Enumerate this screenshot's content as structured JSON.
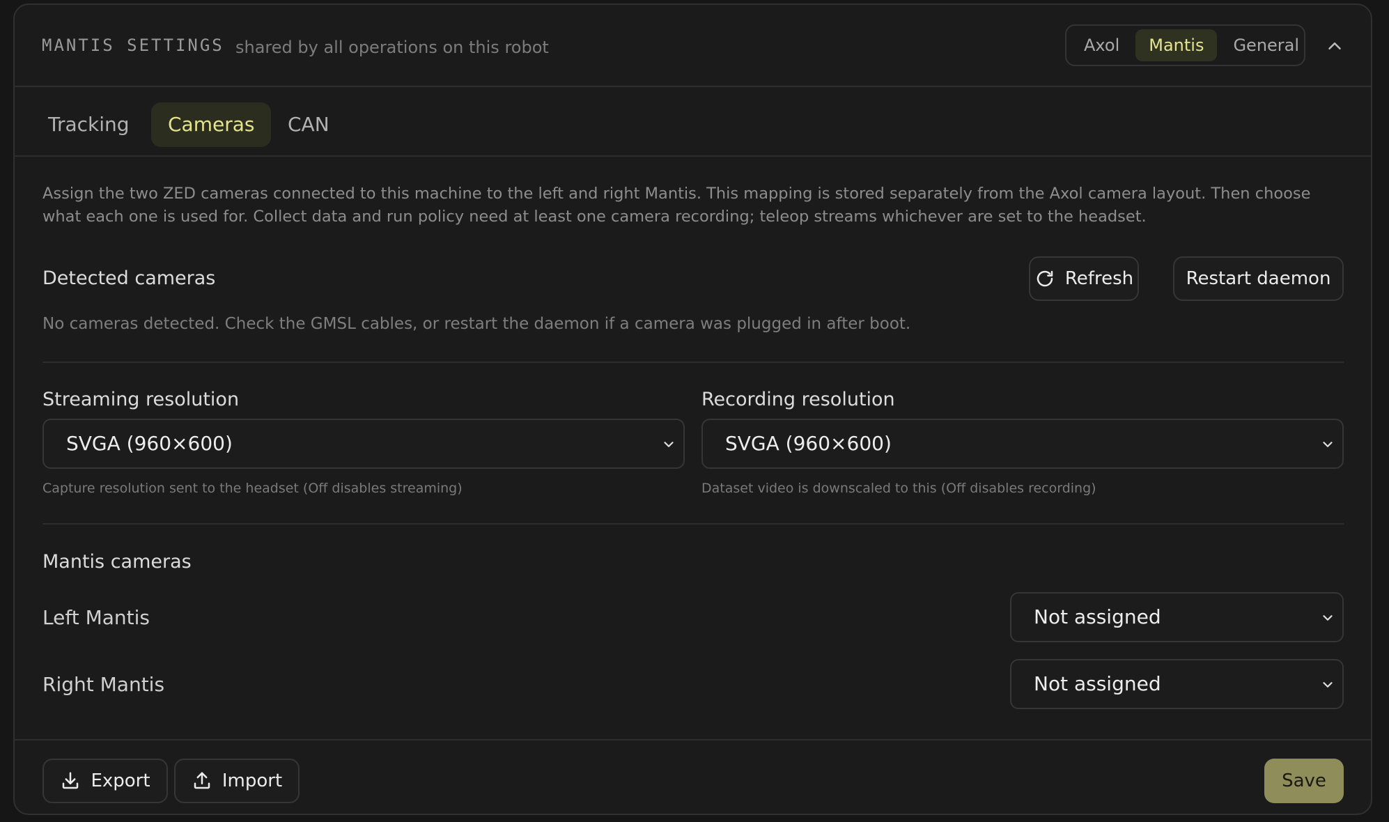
{
  "header": {
    "title": "MANTIS SETTINGS",
    "subtitle": "shared by all operations on this robot",
    "segments": [
      {
        "label": "Axol",
        "active": false
      },
      {
        "label": "Mantis",
        "active": true
      },
      {
        "label": "General",
        "active": false
      }
    ],
    "collapse_icon": "chevron-up-icon"
  },
  "tabs": [
    {
      "label": "Tracking",
      "active": false
    },
    {
      "label": "Cameras",
      "active": true
    },
    {
      "label": "CAN",
      "active": false
    }
  ],
  "cameras": {
    "description": "Assign the two ZED cameras connected to this machine to the left and right Mantis. This mapping is stored separately from the Axol camera layout. Then choose what each one is used for. Collect data and run policy need at least one camera recording; teleop streams whichever are set to the headset.",
    "detected": {
      "title": "Detected cameras",
      "refresh_label": "Refresh",
      "refresh_icon": "refresh-icon",
      "restart_label": "Restart daemon",
      "empty_message": "No cameras detected. Check the GMSL cables, or restart the daemon if a camera was plugged in after boot."
    },
    "streaming": {
      "label": "Streaming resolution",
      "value": "SVGA (960×600)",
      "hint": "Capture resolution sent to the headset (Off disables streaming)"
    },
    "recording": {
      "label": "Recording resolution",
      "value": "SVGA (960×600)",
      "hint": "Dataset video is downscaled to this (Off disables recording)"
    },
    "mantis_cameras": {
      "title": "Mantis cameras",
      "left": {
        "label": "Left Mantis",
        "value": "Not assigned"
      },
      "right": {
        "label": "Right Mantis",
        "value": "Not assigned"
      }
    }
  },
  "footer": {
    "export_label": "Export",
    "export_icon": "download-icon",
    "import_label": "Import",
    "import_icon": "upload-icon",
    "save_label": "Save"
  },
  "colors": {
    "accent": "#e5e38f",
    "save_button": "#8f8d5a",
    "panel_bg": "#1b1b1b"
  }
}
